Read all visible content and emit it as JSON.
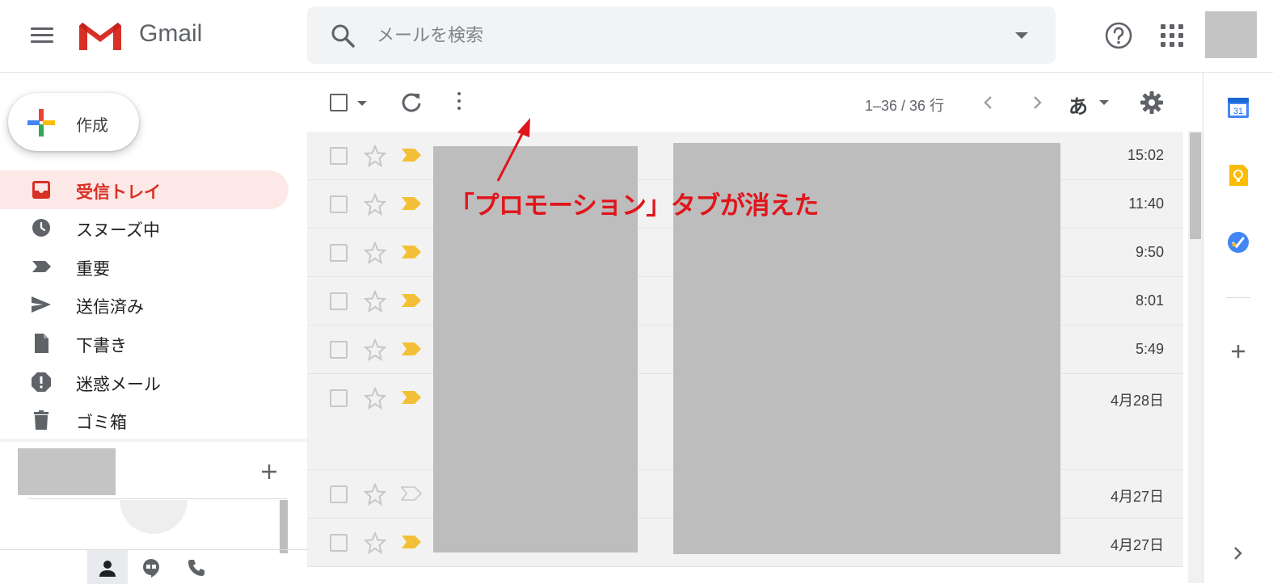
{
  "header": {
    "app_name": "Gmail",
    "search": {
      "placeholder": "メールを検索"
    }
  },
  "sidebar": {
    "compose_label": "作成",
    "items": [
      {
        "label": "受信トレイ",
        "active": true
      },
      {
        "label": "スヌーズ中"
      },
      {
        "label": "重要"
      },
      {
        "label": "送信済み"
      },
      {
        "label": "下書き"
      },
      {
        "label": "迷惑メール"
      },
      {
        "label": "ゴミ箱"
      }
    ]
  },
  "toolbar": {
    "count": "1–36 / 36 行",
    "input_tool": "あ"
  },
  "emails": [
    {
      "time": "15:02",
      "important": true
    },
    {
      "time": "11:40",
      "important": true
    },
    {
      "time": "9:50",
      "important": true
    },
    {
      "time": "8:01",
      "important": true
    },
    {
      "time": "5:49",
      "important": true
    },
    {
      "time": "4月28日",
      "important": true
    },
    {
      "time": "4月27日",
      "important": false
    },
    {
      "time": "4月27日",
      "important": true
    }
  ],
  "side_panel": {
    "calendar_day": "31"
  },
  "annotation": {
    "text": "「プロモーション」タブが消えた",
    "color": "#e0151b"
  },
  "colors": {
    "accent_red": "#d93025",
    "active_bg": "#fce8e6",
    "important_yellow": "#f2c037"
  }
}
